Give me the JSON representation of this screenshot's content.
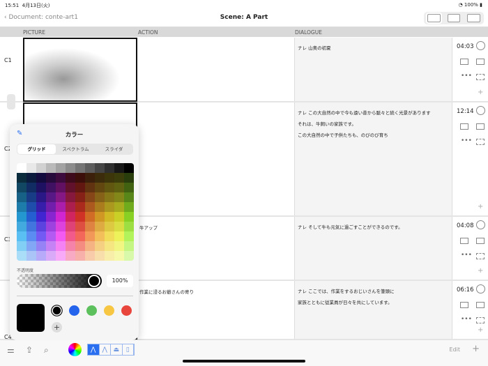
{
  "status": {
    "time": "15:51",
    "date": "4月13日(火)",
    "battery": "100%"
  },
  "nav": {
    "back": "Document: conte-art1",
    "title": "Scene: A Part"
  },
  "columns": {
    "picture": "PICTURE",
    "action": "ACTION",
    "dialogue": "DIALOGUE"
  },
  "rows": [
    {
      "label": "C1",
      "action": "",
      "dialogue": [
        "ナレ 山奥の初夏"
      ],
      "time": "04:03"
    },
    {
      "label": "C2",
      "action": "",
      "dialogue": [
        "ナレ この大自然の中で今も遠い昔から脈々と続く光景があります",
        "それは、牛飼いの家族です。",
        "この大自然の中で子供たちも、のびのび育ち"
      ],
      "time": "12:14"
    },
    {
      "label": "C3",
      "action": "牛アップ",
      "dialogue": [
        "ナレ そして牛も元気に過ごすことができるのです。"
      ],
      "time": "04:08"
    },
    {
      "label": "C4",
      "action": "作業に浸るお爺さんの寄り",
      "dialogue": [
        "ナレ ここでは、作業をするおじいさんを筆頭に",
        "家族とともに従業員が日々を共にしています。"
      ],
      "time": "06:16"
    }
  ],
  "color_picker": {
    "title": "カラー",
    "tabs": [
      "グリッド",
      "スペクトラム",
      "スライダ"
    ],
    "active_tab": "グリッド",
    "opacity_label": "不透明度",
    "opacity": "100%",
    "current_color": "#000000",
    "swatches": [
      "#000000",
      "#2463eb",
      "#5cc15c",
      "#f7c744",
      "#e8453c"
    ]
  },
  "toolbar": {
    "edit": "Edit",
    "pens": [
      "pen",
      "marker",
      "brush",
      "eraser"
    ]
  }
}
